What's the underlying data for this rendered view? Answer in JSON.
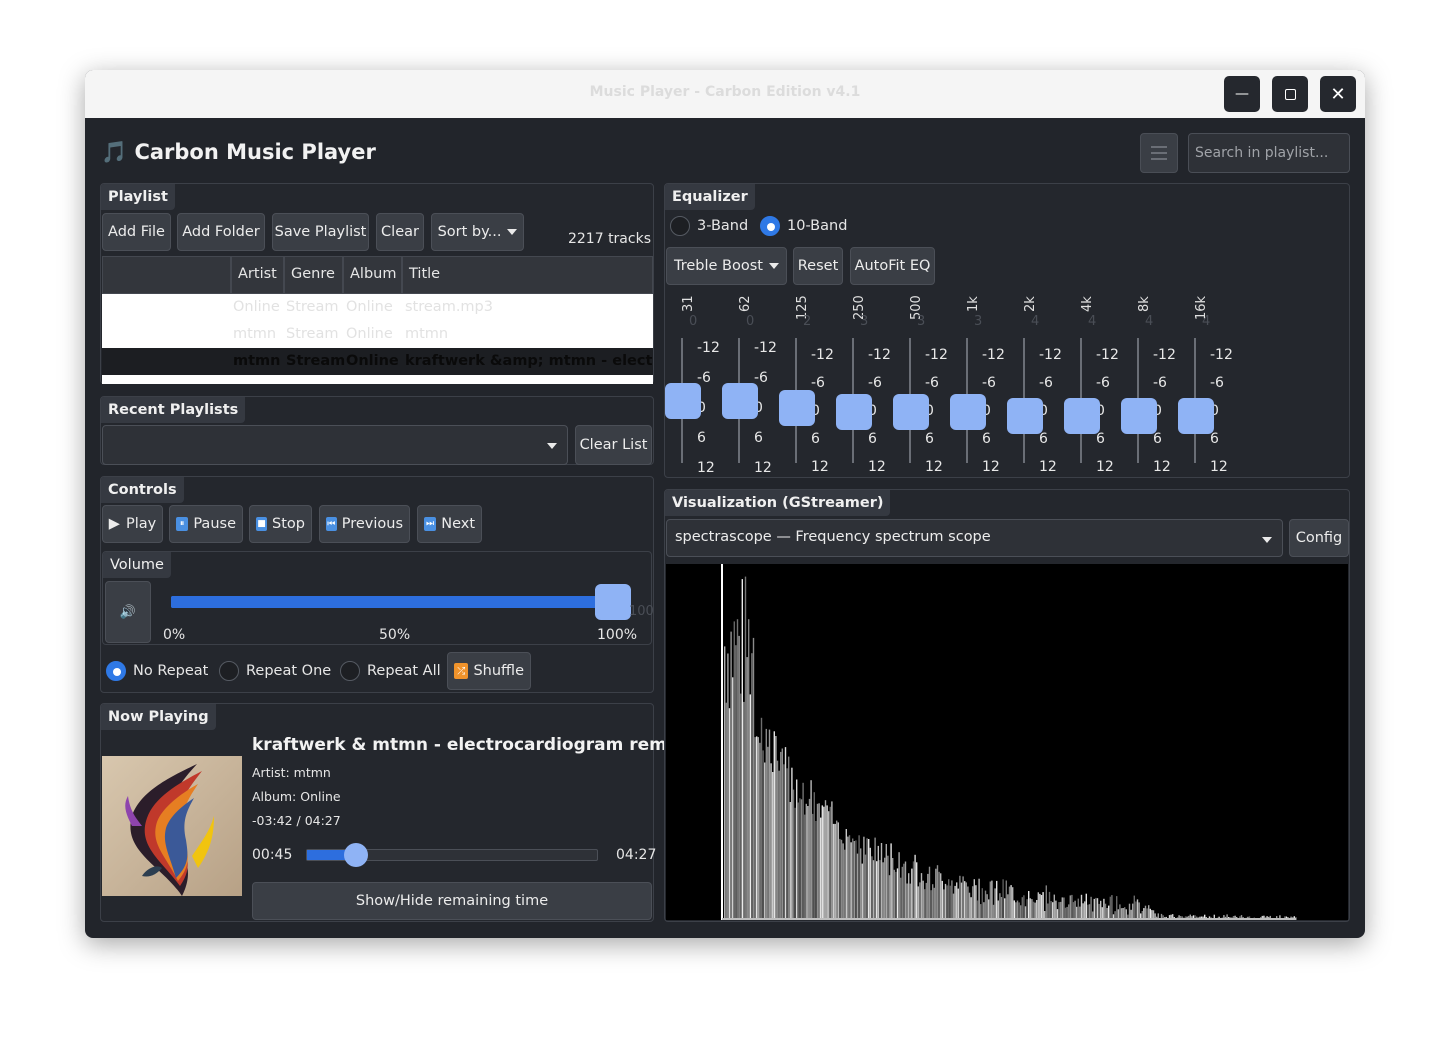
{
  "window": {
    "title": "Music Player - Carbon Edition v4.1",
    "min_icon": "minimize-icon",
    "max_icon": "maximize-icon",
    "close_icon": "close-icon"
  },
  "header": {
    "app_title": "🎵 Carbon Music Player",
    "search_placeholder": "Search in playlist..."
  },
  "playlist": {
    "label": "Playlist",
    "buttons": {
      "add_file": "Add File",
      "add_folder": "Add Folder",
      "save": "Save Playlist",
      "clear": "Clear",
      "sort": "Sort by..."
    },
    "track_count": "2217 tracks",
    "columns": [
      "Artist",
      "Genre",
      "Album",
      "Title"
    ],
    "rows": [
      {
        "artist": "Online",
        "genre": "Stream",
        "album": "Online",
        "title": "stream.mp3"
      },
      {
        "artist": "mtmn",
        "genre": "Stream",
        "album": "Online",
        "title": "mtmn"
      },
      {
        "artist": "mtmn",
        "genre": "Stream",
        "album": "Online",
        "title": "kraftwerk &amp; mtmn - electroc"
      }
    ]
  },
  "recent": {
    "label": "Recent Playlists",
    "selected": "",
    "clear": "Clear List"
  },
  "controls": {
    "label": "Controls",
    "play": "Play",
    "pause": "Pause",
    "stop": "Stop",
    "previous": "Previous",
    "next": "Next",
    "volume_label": "Volume",
    "volume_value": "100",
    "volume_level": 1.0,
    "marks": [
      "0%",
      "50%",
      "100%"
    ],
    "no_repeat": "No Repeat",
    "repeat_one": "Repeat One",
    "repeat_all": "Repeat All",
    "shuffle": "Shuffle",
    "mute_icon": "speaker-icon"
  },
  "now_playing": {
    "label": "Now Playing",
    "title": "kraftwerk & mtmn - electrocardiogram remix",
    "artist": "Artist: mtmn",
    "album": "Album: Online",
    "remaining": "-03:42 / 04:27",
    "elapsed": "00:45",
    "total": "04:27",
    "progress": 0.168,
    "toggle": "Show/Hide remaining time"
  },
  "equalizer": {
    "label": "Equalizer",
    "band3": "3-Band",
    "band10": "10-Band",
    "preset": "Treble Boost",
    "reset": "Reset",
    "autofit": "AutoFit EQ",
    "ticks": [
      "-12",
      "-6",
      "0",
      "6",
      "12"
    ],
    "bands": [
      {
        "freq": "31",
        "value": "0"
      },
      {
        "freq": "62",
        "value": "0"
      },
      {
        "freq": "125",
        "value": "2"
      },
      {
        "freq": "250",
        "value": "3"
      },
      {
        "freq": "500",
        "value": "3"
      },
      {
        "freq": "1k",
        "value": "3"
      },
      {
        "freq": "2k",
        "value": "4"
      },
      {
        "freq": "4k",
        "value": "4"
      },
      {
        "freq": "8k",
        "value": "4"
      },
      {
        "freq": "16k",
        "value": "4"
      }
    ]
  },
  "visualization": {
    "label": "Visualization (GStreamer)",
    "plugin": "spectrascope — Frequency spectrum scope",
    "config": "Config"
  },
  "colors": {
    "accent": "#2d6ede",
    "handle": "#8fb3f5",
    "window_bg": "#22252b",
    "group_bg": "#24272d"
  }
}
